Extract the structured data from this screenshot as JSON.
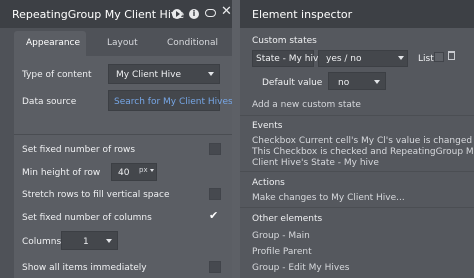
{
  "left": {
    "title": "RepeatingGroup My Client Hive",
    "tabs": [
      "Appearance",
      "Layout",
      "Conditional"
    ],
    "type_label": "Type of content",
    "type_value": "My Client Hive",
    "source_label": "Data source",
    "source_value": "Search for My Client Hives",
    "rows": [
      "Set fixed number of rows",
      "Min height of row",
      "Stretch rows to fill vertical space",
      "Set fixed number of columns",
      "Columns",
      "Show all items immediately"
    ],
    "min_height_value": "40",
    "min_height_unit": "px",
    "columns_value": "1"
  },
  "right": {
    "title": "Element inspector",
    "custom_states": "Custom states",
    "state_name": "State - My hive",
    "state_type": "yes / no",
    "list_label": "List",
    "default_label": "Default value",
    "default_value": "no",
    "add_state": "Add a new custom state",
    "events_title": "Events",
    "event_lines": [
      "Checkbox Current cell's My Cl's value is changed and",
      "This Checkbox is checked and RepeatingGroup My",
      "Client Hive's State - My hive"
    ],
    "actions_title": "Actions",
    "action_text": "Make changes to My Client Hive...",
    "other_title": "Other elements",
    "other_items": [
      "Group - Main",
      "Profile Parent",
      "Group - Edit My Hives"
    ]
  }
}
